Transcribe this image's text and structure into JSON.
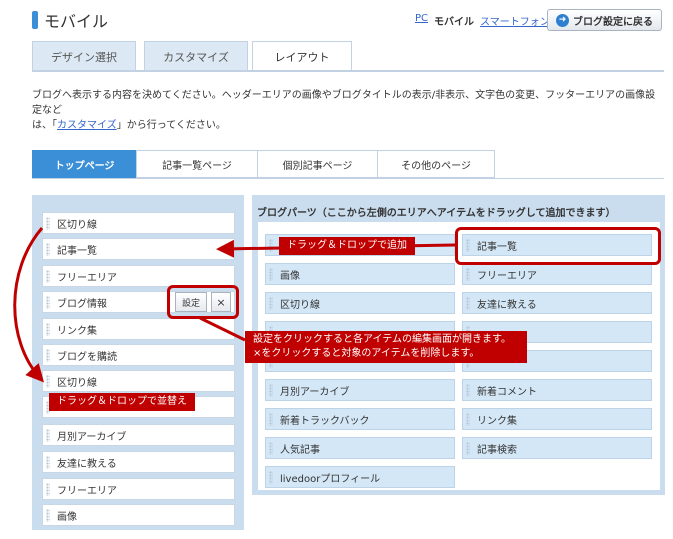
{
  "header": {
    "title": "モバイル",
    "links": {
      "pc": "PC",
      "mobile": "モバイル",
      "smartphone": "スマートフォン"
    },
    "back_button": "ブログ設定に戻る",
    "back_icon": "arrow-right-icon"
  },
  "main_tabs": [
    {
      "label": "デザイン選択"
    },
    {
      "label": "カスタマイズ"
    },
    {
      "label": "レイアウト"
    }
  ],
  "description": {
    "part1": "ブログへ表示する内容を決めてください。ヘッダーエリアの画像やブログタイトルの表示/非表示、文字色の変更、フッターエリアの画像設定など",
    "part2": "は、「",
    "link": "カスタマイズ",
    "part3": "」から行ってください。"
  },
  "sub_tabs": [
    {
      "label": "トップページ"
    },
    {
      "label": "記事一覧ページ"
    },
    {
      "label": "個別記事ページ"
    },
    {
      "label": "その他のページ"
    }
  ],
  "left_items": [
    "区切り線",
    "記事一覧",
    "フリーエリア",
    "ブログ情報",
    "リンク集",
    "ブログを購読",
    "区切り線",
    "",
    "月別アーカイブ",
    "友達に教える",
    "フリーエリア",
    "画像"
  ],
  "item_buttons": {
    "settings": "設定",
    "close": "×"
  },
  "right_panel": {
    "title": "ブログパーツ（ここから左側のエリアへアイテムをドラッグして追加できます）",
    "items": [
      "",
      "記事一覧",
      "画像",
      "フリーエリア",
      "区切り線",
      "友達に教える",
      "",
      "",
      "",
      "",
      "月別アーカイブ",
      "新着コメント",
      "新着トラックバック",
      "リンク集",
      "人気記事",
      "記事検索",
      "livedoorプロフィール",
      ""
    ]
  },
  "callouts": {
    "add": "ドラッグ＆ドロップで追加",
    "settings_line1": "設定をクリックすると各アイテムの編集画面が開きます。",
    "settings_line2": "×をクリックすると対象のアイテムを削除します。",
    "reorder": "ドラッグ＆ドロップで並替え"
  },
  "colors": {
    "accent": "#3a8fd6",
    "annotation": "#c00000",
    "panel": "#c9ddef",
    "right_item": "#d4e7f6"
  }
}
